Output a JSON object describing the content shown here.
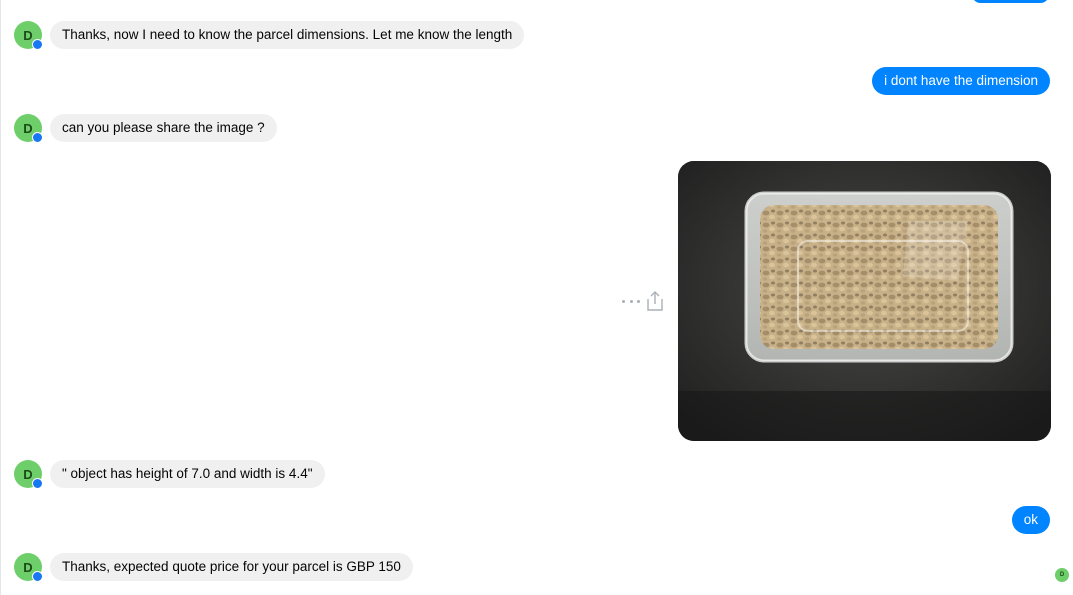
{
  "contact": {
    "avatar_letter": "D",
    "avatar_color": "#6ecf6a",
    "badge_icon": "messenger-badge-icon"
  },
  "theme": {
    "outgoing_bubble_color": "#0084ff",
    "incoming_bubble_color": "#f0f0f0"
  },
  "messages": [
    {
      "direction": "incoming",
      "text": "Thanks, now I need to know the parcel dimensions. Let me know the length"
    },
    {
      "direction": "outgoing",
      "text": "i dont have the dimension"
    },
    {
      "direction": "incoming",
      "text": "can you please share the image ?"
    },
    {
      "direction": "outgoing",
      "type": "image",
      "subject": "plastic container of mixed nuts"
    },
    {
      "direction": "incoming",
      "text": "\" object has height of 7.0 and width is 4.4\""
    },
    {
      "direction": "outgoing",
      "text": "ok"
    },
    {
      "direction": "incoming",
      "text": "Thanks, expected quote price for your parcel is GBP 150"
    }
  ],
  "photo_actions": {
    "more_icon": "more-options-icon",
    "share_icon": "share-icon"
  },
  "seen_indicator": {
    "letter": "D"
  }
}
